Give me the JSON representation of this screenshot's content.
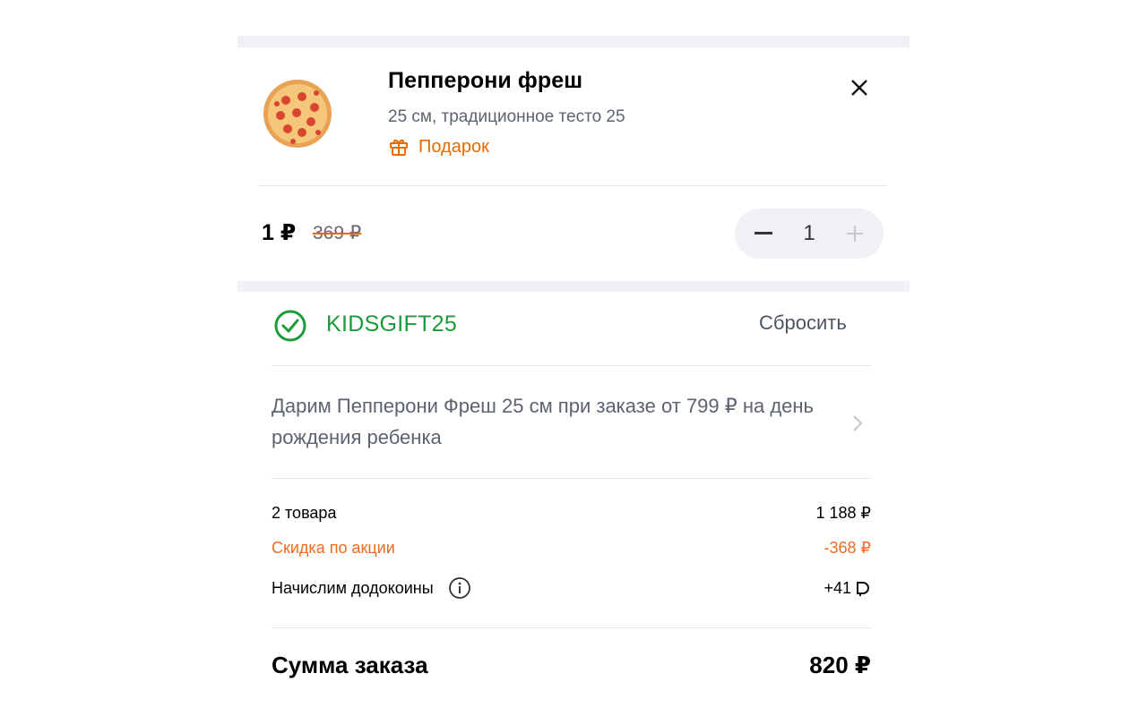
{
  "item": {
    "title": "Пепперони фреш",
    "subtitle": "25 см, традиционное тесто 25",
    "gift_label": "Подарок",
    "price_current": "1 ₽",
    "price_old": "369 ₽",
    "quantity": "1"
  },
  "promo": {
    "code": "KIDSGIFT25",
    "reset_label": "Сбросить",
    "description": "Дарим Пепперони Фреш 25 см при заказе от 799 ₽ на день рождения ребенка"
  },
  "summary": {
    "items_label": "2 товара",
    "items_value": "1 188 ₽",
    "discount_label": "Скидка по акции",
    "discount_value": "-368 ₽",
    "coins_label": "Начислим додокоины",
    "coins_value": "+41",
    "total_label": "Сумма заказа",
    "total_value": "820 ₽"
  },
  "colors": {
    "accent_orange": "#f26b1d",
    "promo_green": "#1b9b3a",
    "strip_gray": "#f1f1f5"
  },
  "icons": {
    "close": "close-icon",
    "gift": "gift-icon",
    "minus": "minus-icon",
    "plus": "plus-icon",
    "check": "check-circle-icon",
    "chevron": "chevron-right-icon",
    "info": "info-icon",
    "coin": "dodocoin-icon"
  }
}
